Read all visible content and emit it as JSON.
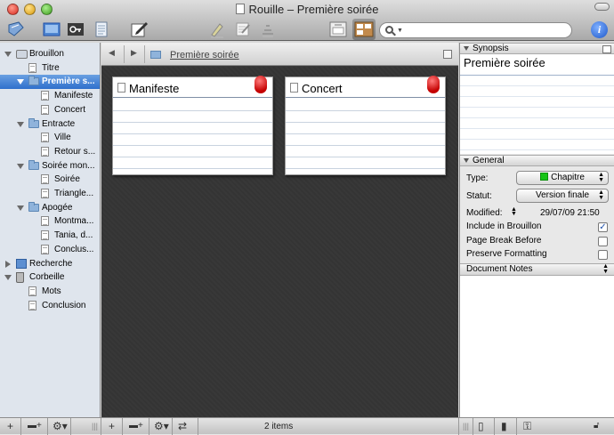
{
  "window": {
    "title": "Rouille – Première soirée"
  },
  "toolbar": {
    "search": {
      "value": "",
      "placeholder": ""
    },
    "info_label": "i",
    "icons": [
      "binder-toggle-icon",
      "doc-view-icon",
      "key-icon",
      "page-icon",
      "compose-icon",
      "highlighter-icon",
      "annotation-icon",
      "snapshot-icon",
      "scrivenings-icon",
      "corkboard-icon",
      "search-icon",
      "info-icon"
    ]
  },
  "binder": {
    "items": [
      {
        "label": "Brouillon",
        "kind": "draft",
        "level": 0,
        "expanded": true
      },
      {
        "label": "Titre",
        "kind": "doc",
        "level": 1
      },
      {
        "label": "Première s...",
        "kind": "folder",
        "level": 1,
        "expanded": true,
        "selected": true
      },
      {
        "label": "Manifeste",
        "kind": "doc",
        "level": 2
      },
      {
        "label": "Concert",
        "kind": "doc",
        "level": 2
      },
      {
        "label": "Entracte",
        "kind": "folder",
        "level": 1,
        "expanded": true
      },
      {
        "label": "Ville",
        "kind": "doc",
        "level": 2
      },
      {
        "label": "Retour s...",
        "kind": "doc",
        "level": 2
      },
      {
        "label": "Soirée mon...",
        "kind": "folder",
        "level": 1,
        "expanded": true
      },
      {
        "label": "Soirée",
        "kind": "doc",
        "level": 2
      },
      {
        "label": "Triangle...",
        "kind": "doc",
        "level": 2
      },
      {
        "label": "Apogée",
        "kind": "folder",
        "level": 1,
        "expanded": true
      },
      {
        "label": "Montma...",
        "kind": "doc",
        "level": 2
      },
      {
        "label": "Tania, d...",
        "kind": "doc",
        "level": 2
      },
      {
        "label": "Conclus...",
        "kind": "doc",
        "level": 2
      },
      {
        "label": "Recherche",
        "kind": "research",
        "level": 0,
        "expanded": false
      },
      {
        "label": "Corbeille",
        "kind": "trash",
        "level": 0,
        "expanded": true
      },
      {
        "label": "Mots",
        "kind": "doc",
        "level": 1
      },
      {
        "label": "Conclusion",
        "kind": "doc",
        "level": 1
      }
    ]
  },
  "editor": {
    "breadcrumb": "Première soirée",
    "cards": [
      {
        "title": "Manifeste"
      },
      {
        "title": "Concert"
      }
    ],
    "item_count": "2 items"
  },
  "inspector": {
    "synopsis_header": "Synopsis",
    "synopsis_title": "Première soirée",
    "general_header": "General",
    "type_label": "Type:",
    "type_value": "Chapitre",
    "type_color": "#16c416",
    "status_label": "Statut:",
    "status_value": "Version finale",
    "modified_label": "Modified:",
    "modified_value": "29/07/09 21:50",
    "include_label": "Include in Brouillon",
    "include_checked": true,
    "pagebreak_label": "Page Break Before",
    "pagebreak_checked": false,
    "preserve_label": "Preserve Formatting",
    "preserve_checked": false,
    "notes_header": "Document Notes"
  },
  "colors": {
    "selection": "#2e6fcc",
    "corkboard": "#383838",
    "pin": "#c40000"
  }
}
